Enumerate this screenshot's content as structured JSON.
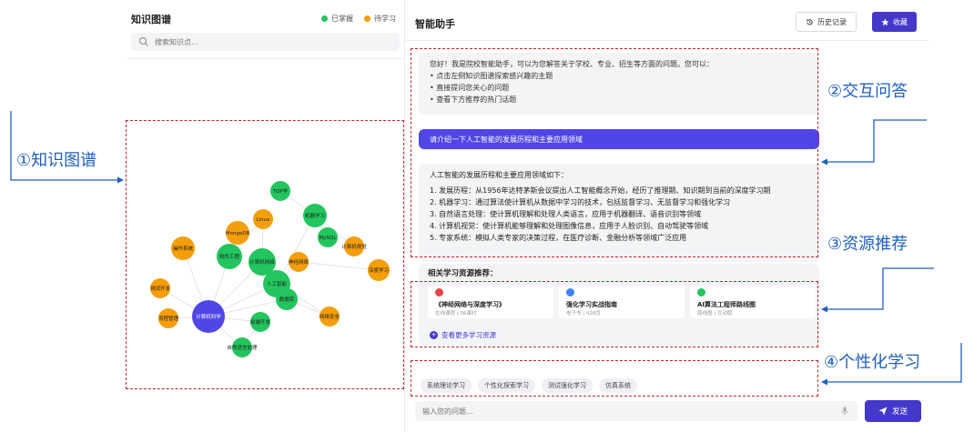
{
  "left": {
    "title": "知识图谱",
    "legend": [
      {
        "label": "已掌握",
        "color": "#22c55e"
      },
      {
        "label": "待学习",
        "color": "#f59e0b"
      }
    ],
    "search_placeholder": "搜索知识点..."
  },
  "graph": {
    "nodes": [
      {
        "id": "top",
        "label": "TOP学",
        "status": "mastered"
      },
      {
        "id": "ml",
        "label": "机器学习",
        "status": "mastered"
      },
      {
        "id": "linux",
        "label": "Linux",
        "status": "pending"
      },
      {
        "id": "mongodb",
        "label": "MongoDB",
        "status": "pending"
      },
      {
        "id": "mysql",
        "label": "MySQL",
        "status": "mastered"
      },
      {
        "id": "os",
        "label": "操作系统",
        "status": "pending"
      },
      {
        "id": "se",
        "label": "软件工程",
        "status": "mastered"
      },
      {
        "id": "cn",
        "label": "计算机网络",
        "status": "mastered"
      },
      {
        "id": "nn",
        "label": "神经网络",
        "status": "pending"
      },
      {
        "id": "cv",
        "label": "计算机视觉",
        "status": "pending"
      },
      {
        "id": "ds",
        "label": "深度学习",
        "status": "pending"
      },
      {
        "id": "ai",
        "label": "人工智能",
        "status": "mastered"
      },
      {
        "id": "dst",
        "label": "数据库",
        "status": "mastered"
      },
      {
        "id": "test",
        "label": "测试开发",
        "status": "pending"
      },
      {
        "id": "pm",
        "label": "流程管理",
        "status": "pending"
      },
      {
        "id": "center",
        "label": "计算机科学",
        "status": "center"
      },
      {
        "id": "fe",
        "label": "前端开发",
        "status": "mastered"
      },
      {
        "id": "sec",
        "label": "网络安全",
        "status": "pending"
      },
      {
        "id": "nlp",
        "label": "自然语言处理",
        "status": "mastered"
      }
    ]
  },
  "right": {
    "title": "智能助手",
    "history_label": "历史记录",
    "favorite_label": "收藏"
  },
  "welcome": {
    "intro": "您好！我是院校智能助手，可以为您解答关于学校、专业、招生等方面的问题。您可以：",
    "bullets": [
      "• 点击左侧知识图谱探索感兴趣的主题",
      "• 直接提问您关心的问题",
      "• 查看下方推荐的热门话题"
    ]
  },
  "user_message": "请介绍一下人工智能的发展历程和主要应用领域",
  "answer": {
    "heading": "人工智能的发展历程和主要应用领域如下：",
    "lines": [
      "1. 发展历程：从1956年达特茅斯会议提出人工智能概念开始，经历了推理期、知识期到当前的深度学习期",
      "2. 机器学习：通过算法使计算机从数据中学习的技术，包括监督学习、无监督学习和强化学习",
      "3. 自然语言处理：使计算机理解和处理人类语言，应用于机器翻译、语音识别等领域",
      "4. 计算机视觉：使计算机能够理解和处理图像信息，应用于人脸识别、自动驾驶等领域",
      "5. 专家系统：模拟人类专家的决策过程，在医疗诊断、金融分析等领域广泛应用"
    ]
  },
  "resources": {
    "title": "相关学习资源推荐：",
    "cards": [
      {
        "name": "《神经网络与深度学习》",
        "meta": "在线课程 | 36课时",
        "icon": "book-icon",
        "color": "#ef4444"
      },
      {
        "name": "强化学习实战指南",
        "meta": "电子书 | 428页",
        "icon": "ebook-icon",
        "color": "#3b82f6"
      },
      {
        "name": "AI算法工程师路线图",
        "meta": "路线图 | 互动版",
        "icon": "map-icon",
        "color": "#22c55e"
      }
    ],
    "more_label": "查看更多学习资源"
  },
  "chips": [
    "系统理论学习",
    "个性化探索学习",
    "测试强化学习",
    "仿真系统"
  ],
  "input": {
    "placeholder": "输入您的问题...",
    "send_label": "发送"
  },
  "annotations": {
    "kg": "①知识图谱",
    "qa": "②交互问答",
    "res": "③资源推荐",
    "pl": "④个性化学习"
  },
  "colors": {
    "mastered": "#22c55e",
    "pending": "#f59e0b",
    "center": "#4f46e5",
    "accent": "#4338ca",
    "annotation_box": "#c0262d",
    "annotation_text": "#1f5fbf"
  }
}
